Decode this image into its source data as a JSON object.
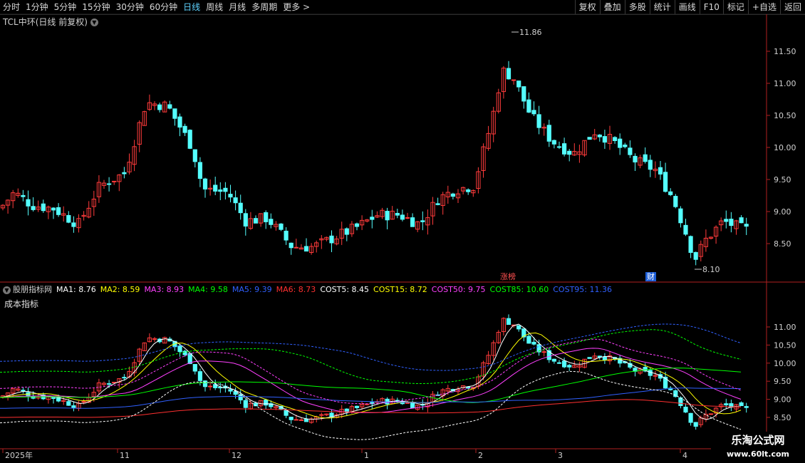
{
  "toolbar": {
    "periods": [
      "分时",
      "1分钟",
      "5分钟",
      "15分钟",
      "30分钟",
      "60分钟",
      "日线",
      "周线",
      "月线",
      "多周期",
      "更多 >"
    ],
    "active_period": "日线",
    "buttons": [
      "复权",
      "叠加",
      "多股",
      "统计",
      "画线",
      "F10",
      "标记",
      "+自选",
      "返回"
    ]
  },
  "main_chart": {
    "title": "TCL中环(日线 前复权)",
    "y_ticks": [
      "11.50",
      "11.00",
      "10.50",
      "10.00",
      "9.50",
      "9.00",
      "8.50"
    ],
    "high_label": "11.86",
    "low_label": "8.10",
    "badge_zhangbang": "涨榜",
    "badge_cai": "财"
  },
  "indicator": {
    "name": "股朋指标网",
    "subtitle": "成本指标",
    "values": [
      {
        "label": "MA1: 8.76",
        "color": "#ffffff"
      },
      {
        "label": "MA2: 8.59",
        "color": "#ffff00"
      },
      {
        "label": "MA3: 8.93",
        "color": "#ff40ff"
      },
      {
        "label": "MA4: 9.58",
        "color": "#00ff00"
      },
      {
        "label": "MA5: 9.39",
        "color": "#3060ff"
      },
      {
        "label": "MA6: 8.73",
        "color": "#ff3030"
      },
      {
        "label": "COST5: 8.45",
        "color": "#ffffff"
      },
      {
        "label": "COST15: 8.72",
        "color": "#ffff00"
      },
      {
        "label": "COST50: 9.75",
        "color": "#ff40ff"
      },
      {
        "label": "COST85: 10.60",
        "color": "#00ff00"
      },
      {
        "label": "COST95: 11.36",
        "color": "#3060ff"
      }
    ],
    "y_ticks": [
      "11.00",
      "10.50",
      "10.00",
      "9.50",
      "9.00",
      "8.50"
    ]
  },
  "time_axis": [
    "2025年",
    "11",
    "12",
    "1",
    "2",
    "3",
    "4"
  ],
  "watermark": {
    "line1": "乐淘公式网",
    "line2": "www.60lt.com"
  },
  "colors": {
    "up": "#ff3b3b",
    "down": "#54ffff",
    "axis": "#b02020",
    "grid": "#3a0000"
  }
}
